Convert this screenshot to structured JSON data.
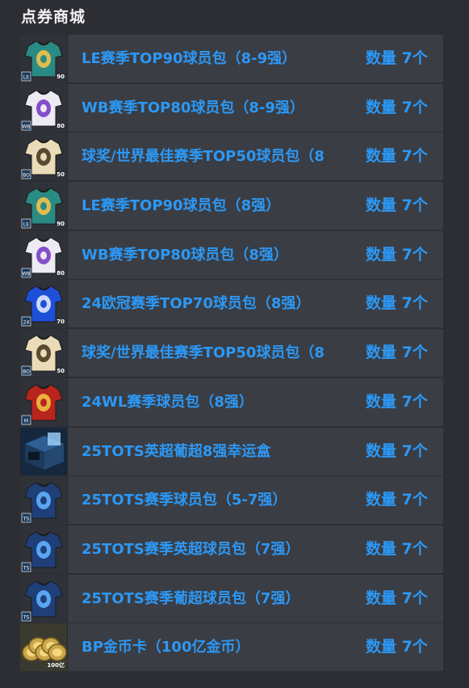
{
  "page": {
    "title": "点券商城"
  },
  "qty_label": "数量 7个",
  "items": [
    {
      "name": "LE赛季TOP90球员包（8-9强）",
      "quantity": "数量 7个",
      "icon": "jersey-le-icon",
      "jersey": "#2a8a84",
      "emblem": "#f4c24a",
      "badge": "LE",
      "num": "90"
    },
    {
      "name": "WB赛季TOP80球员包（8-9强）",
      "quantity": "数量 7个",
      "icon": "jersey-wb-icon",
      "jersey": "#eceaf2",
      "emblem": "#7a3cc8",
      "badge": "WB",
      "num": "80"
    },
    {
      "name": "球奖/世界最佳赛季TOP50球员包（8",
      "quantity": "数量 7个",
      "icon": "jersey-award-icon",
      "jersey": "#eadcb8",
      "emblem": "#4a3a22",
      "badge": "BO",
      "num": "50"
    },
    {
      "name": "LE赛季TOP90球员包（8强）",
      "quantity": "数量 7个",
      "icon": "jersey-le-icon",
      "jersey": "#2a8a84",
      "emblem": "#f4c24a",
      "badge": "LE",
      "num": "90"
    },
    {
      "name": "WB赛季TOP80球员包（8强）",
      "quantity": "数量 7个",
      "icon": "jersey-wb-icon",
      "jersey": "#eceaf2",
      "emblem": "#7a3cc8",
      "badge": "WB",
      "num": "80"
    },
    {
      "name": "24欧冠赛季TOP70球员包（8强）",
      "quantity": "数量 7个",
      "icon": "jersey-ucl-icon",
      "jersey": "#1e4fd8",
      "emblem": "#dfe8ff",
      "badge": "24",
      "num": "70"
    },
    {
      "name": "球奖/世界最佳赛季TOP50球员包（8",
      "quantity": "数量 7个",
      "icon": "jersey-award-icon",
      "jersey": "#eadcb8",
      "emblem": "#4a3a22",
      "badge": "BO",
      "num": "50"
    },
    {
      "name": "24WL赛季球员包（8强）",
      "quantity": "数量 7个",
      "icon": "jersey-wl-icon",
      "jersey": "#b8241e",
      "emblem": "#f0c040",
      "badge": "M",
      "num": ""
    },
    {
      "name": "25TOTS英超葡超8强幸运盒",
      "quantity": "数量 7个",
      "icon": "lucky-box-icon",
      "jersey": "#1c3a5c",
      "emblem": "#9fd4ff",
      "badge": "",
      "num": ""
    },
    {
      "name": "25TOTS赛季球员包（5-7强）",
      "quantity": "数量 7个",
      "icon": "jersey-tots-icon",
      "jersey": "#1f3f78",
      "emblem": "#5fb0ff",
      "badge": "TS",
      "num": ""
    },
    {
      "name": "25TOTS赛季英超球员包（7强）",
      "quantity": "数量 7个",
      "icon": "jersey-tots-icon",
      "jersey": "#1f3f78",
      "emblem": "#5fb0ff",
      "badge": "TS",
      "num": ""
    },
    {
      "name": "25TOTS赛季葡超球员包（7强）",
      "quantity": "数量 7个",
      "icon": "jersey-tots-icon",
      "jersey": "#1f3f78",
      "emblem": "#5fb0ff",
      "badge": "TS",
      "num": ""
    },
    {
      "name": "BP金币卡（100亿金币）",
      "quantity": "数量 7个",
      "icon": "gold-coins-icon",
      "jersey": "#c9a64a",
      "emblem": "#f3d77a",
      "badge": "",
      "num": "100亿"
    }
  ]
}
